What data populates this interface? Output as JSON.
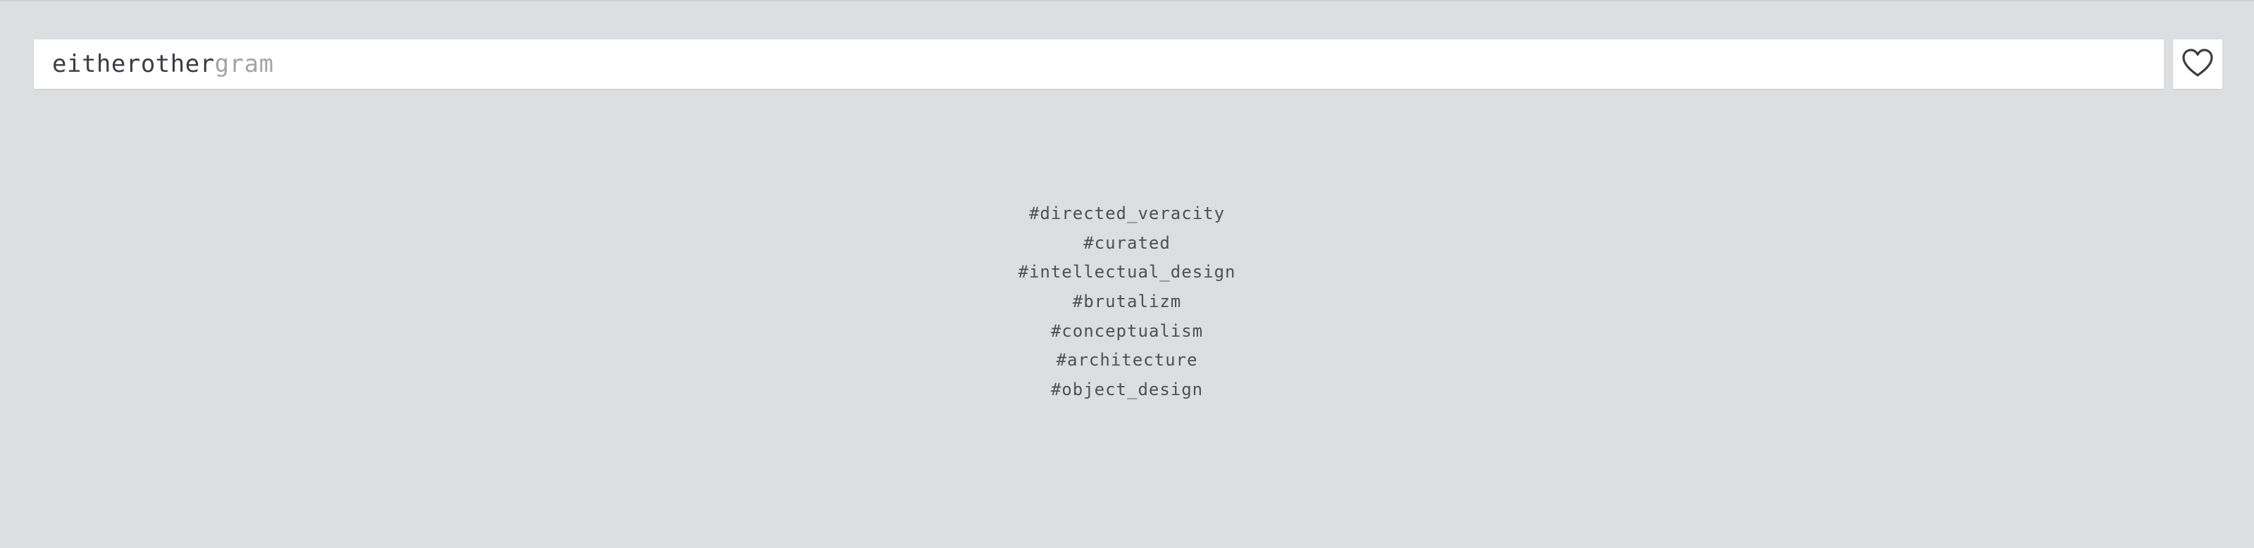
{
  "brand": {
    "name_dark": "eitherother",
    "name_light": "gram"
  },
  "header": {
    "favorites_icon": "heart-icon"
  },
  "tags": [
    "#directed_veracity",
    "#curated",
    "#intellectual_design",
    "#brutalizm",
    "#conceptualism",
    "#architecture",
    "#object_design"
  ],
  "colors": {
    "background": "#dddee0",
    "panel": "#ffffff",
    "text_dark": "#3b3d42",
    "text_light": "#a3a4a8",
    "tag_text": "#4e5055"
  }
}
